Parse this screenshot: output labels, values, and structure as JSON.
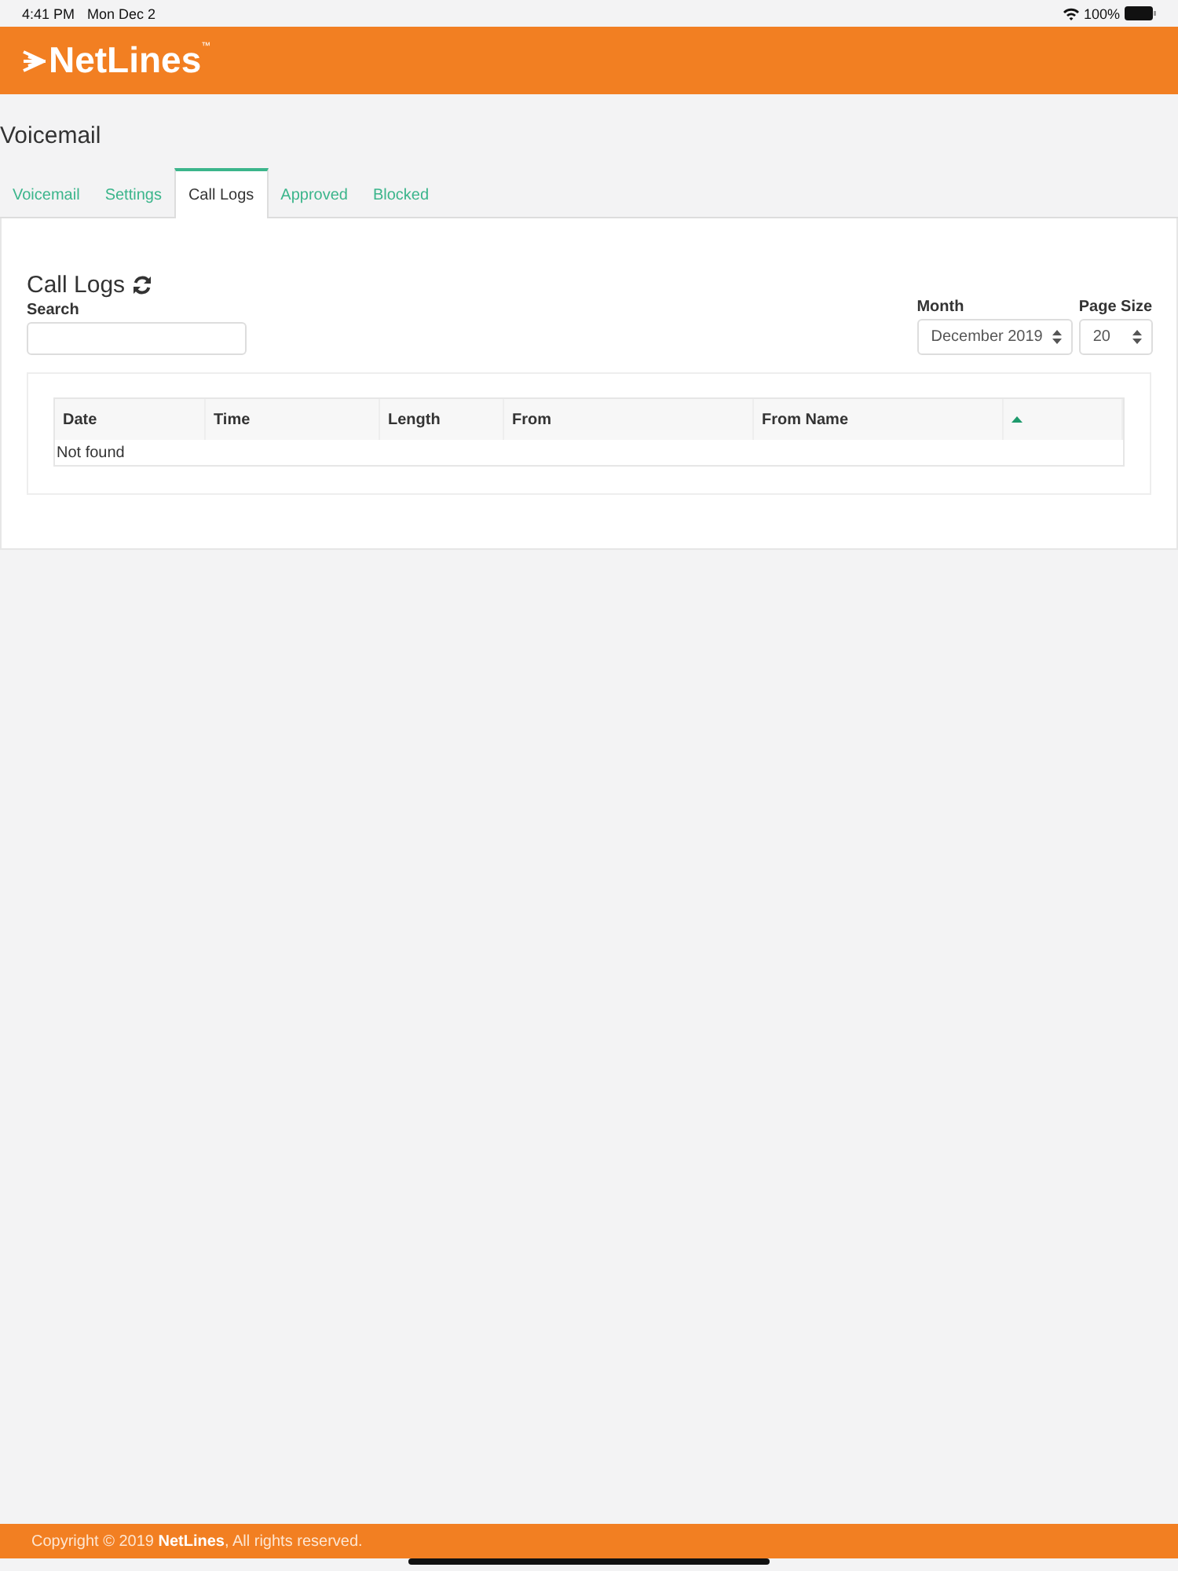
{
  "status_bar": {
    "time": "4:41 PM",
    "date": "Mon Dec 2",
    "battery": "100%"
  },
  "header": {
    "logo": "NetLines",
    "trademark": "™"
  },
  "page_title": "Voicemail",
  "tabs": [
    {
      "label": "Voicemail",
      "selected": false
    },
    {
      "label": "Settings",
      "selected": false
    },
    {
      "label": "Call Logs",
      "selected": true
    },
    {
      "label": "Approved",
      "selected": false
    },
    {
      "label": "Blocked",
      "selected": false
    }
  ],
  "panel": {
    "title": "Call Logs",
    "search": {
      "label": "Search"
    },
    "month": {
      "label": "Month",
      "value": "December 2019"
    },
    "page_size": {
      "label": "Page Size",
      "value": "20"
    },
    "table": {
      "columns": [
        {
          "label": "Date"
        },
        {
          "label": "Time"
        },
        {
          "label": "Length"
        },
        {
          "label": "From"
        },
        {
          "label": "From Name"
        }
      ],
      "sort": {
        "ascending": true
      },
      "empty_text": "Not found"
    }
  },
  "footer": {
    "text": "Copyright © 2019 **NetLines**, All rights reserved."
  }
}
